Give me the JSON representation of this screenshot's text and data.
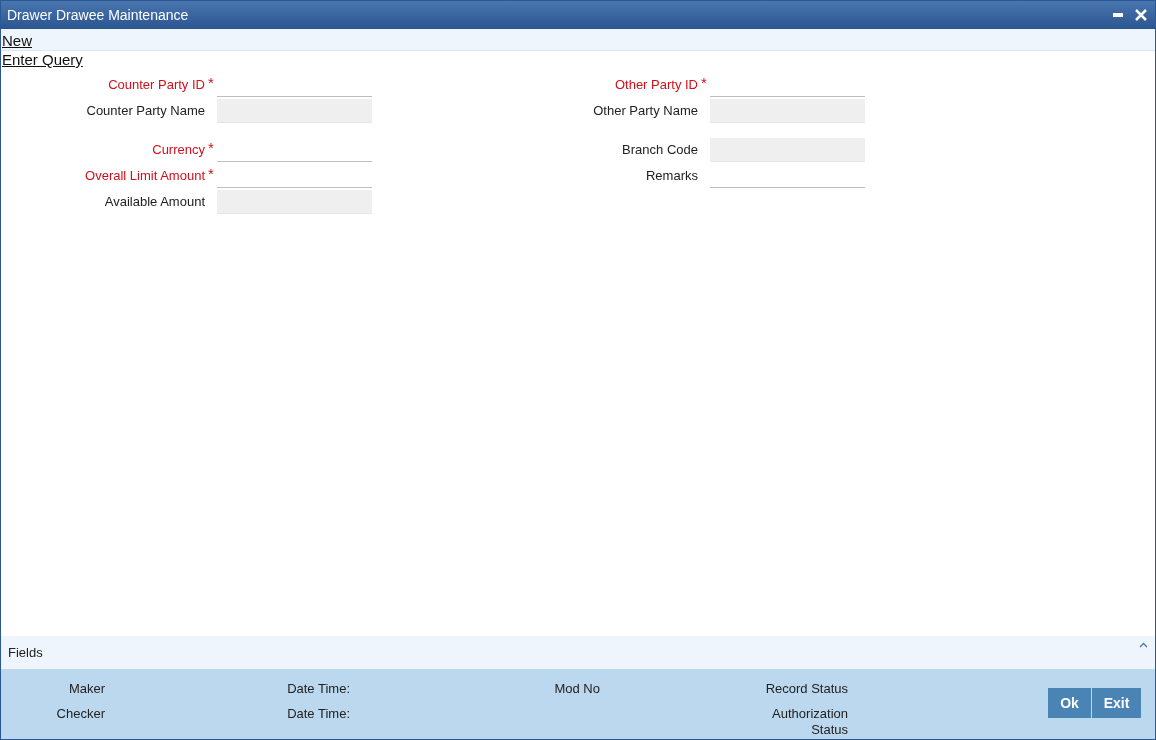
{
  "window": {
    "title": "Drawer Drawee Maintenance"
  },
  "toolbar": [
    {
      "label": "New"
    },
    {
      "label": "Enter Query"
    }
  ],
  "form": {
    "columns": [
      [
        [
          {
            "label": "Counter Party ID",
            "mark": "*",
            "editable": true
          },
          {
            "label": "Counter Party Name",
            "editable": false
          }
        ],
        [
          {
            "label": "Currency",
            "mark": "*",
            "editable": true
          },
          {
            "label": "Overall Limit Amount",
            "mark": "*",
            "editable": true
          },
          {
            "label": "Available Amount",
            "editable": false
          }
        ]
      ],
      [
        [
          {
            "label": "Other Party ID",
            "mark": "*",
            "editable": true
          },
          {
            "label": "Other Party Name",
            "editable": false
          }
        ],
        [
          {
            "label": "Branch Code",
            "editable": false
          },
          {
            "label": "Remarks",
            "editable": true
          }
        ]
      ]
    ]
  },
  "fields_bar": {
    "label": "Fields",
    "expanded": true
  },
  "audit": [
    {
      "top": "Maker",
      "bottom": "Checker"
    },
    {
      "top": "Date Time:",
      "bottom": "Date Time:"
    },
    {
      "top": "Mod No"
    },
    {
      "top": "Record Status",
      "bottom": "Authorization Status"
    }
  ],
  "buttons": [
    "Ok",
    "Exit"
  ]
}
